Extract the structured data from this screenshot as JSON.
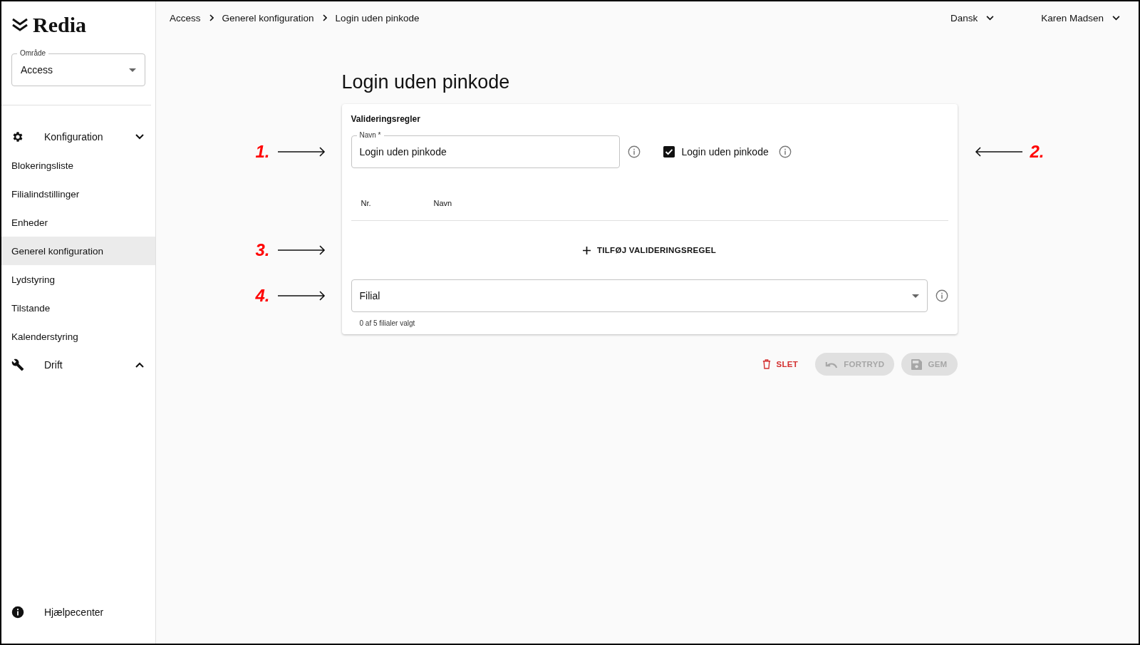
{
  "sidebar": {
    "logo": "Redia",
    "area_select": {
      "label": "Område",
      "value": "Access"
    },
    "groups": [
      {
        "label": "Konfiguration",
        "kind": "settings",
        "expanded": true,
        "items": [
          {
            "label": "Blokeringsliste",
            "selected": false
          },
          {
            "label": "Filialindstillinger",
            "selected": false
          },
          {
            "label": "Enheder",
            "selected": false
          },
          {
            "label": "Generel konfiguration",
            "selected": true
          },
          {
            "label": "Lydstyring",
            "selected": false
          },
          {
            "label": "Tilstande",
            "selected": false
          },
          {
            "label": "Kalenderstyring",
            "selected": false
          }
        ]
      },
      {
        "label": "Drift",
        "kind": "operations",
        "expanded": false
      }
    ],
    "help": "Hjælpecenter"
  },
  "breadcrumb": [
    "Access",
    "Generel konfiguration",
    "Login uden pinkode"
  ],
  "language": "Dansk",
  "user": "Karen Madsen",
  "page_title": "Login uden pinkode",
  "card": {
    "section_title": "Valideringsregler",
    "name_field": {
      "label": "Navn *",
      "value": "Login uden pinkode",
      "annotation": "1."
    },
    "checkbox": {
      "label": "Login uden pinkode",
      "checked": true,
      "annotation": "2."
    },
    "table": {
      "columns": [
        "Nr.",
        "Navn"
      ]
    },
    "add_button": {
      "label": "TILFØJ VALIDERINGSREGEL",
      "annotation": "3."
    },
    "branch_select": {
      "label": "Filial",
      "helper": "0 af 5 filialer valgt",
      "annotation": "4."
    }
  },
  "actions": [
    {
      "label": "SLET",
      "kind": "delete",
      "disabled": false
    },
    {
      "label": "FORTRYD",
      "kind": "undo",
      "disabled": true
    },
    {
      "label": "GEM",
      "kind": "save",
      "disabled": true
    }
  ]
}
